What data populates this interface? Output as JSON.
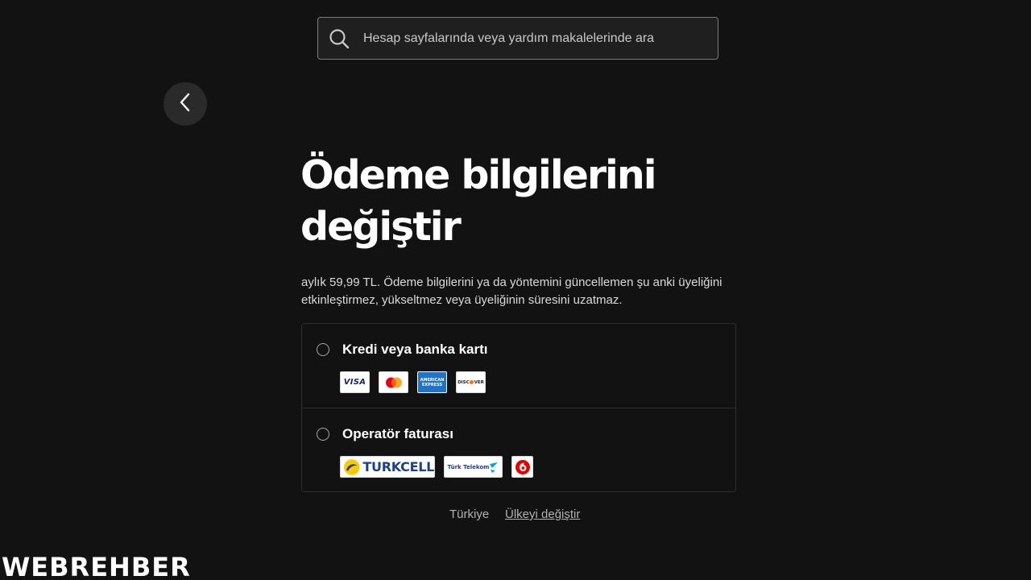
{
  "search": {
    "placeholder": "Hesap sayfalarında veya yardım makalelerinde ara",
    "icon": "search-icon"
  },
  "navigation": {
    "back_icon": "chevron-left-icon"
  },
  "main": {
    "title": "Ödeme bilgilerini değiştir",
    "description": "aylık 59,99 TL. Ödeme bilgilerini ya da yöntemini güncellemen şu anki üyeliğini etkinleştirmez, yükseltmez veya üyeliğinin süresini uzatmaz."
  },
  "payment_options": [
    {
      "label": "Kredi veya banka kartı",
      "selected": false,
      "logos": [
        "VISA",
        "Mastercard",
        "AMERICAN EXPRESS",
        "DISCOVER"
      ]
    },
    {
      "label": "Operatör faturası",
      "selected": false,
      "logos": [
        "TURKCELL",
        "Türk Telekom",
        "Vodafone"
      ]
    }
  ],
  "logo_text": {
    "visa": "VISA",
    "amex_line1": "AMERICAN",
    "amex_line2": "EXPRESS",
    "discover_pre": "DISC",
    "discover_post": "VER",
    "turkcell": "TURKCELL",
    "telekom": "Türk Telekom"
  },
  "footer": {
    "country": "Türkiye",
    "change_country_label": "Ülkeyi değiştir"
  },
  "watermark": {
    "text": "WEBREHBER"
  },
  "colors": {
    "background": "#121212",
    "text_primary": "#ffffff",
    "text_secondary": "#b3b3b3",
    "border": "#2e2e2e",
    "search_border": "#7c7c7c",
    "back_button_bg": "#2a2a2a",
    "turkcell_yellow": "#ffc900",
    "turkcell_blue": "#1d3f8e",
    "mastercard_red": "#eb001b",
    "mastercard_orange": "#f79e1b",
    "amex_blue": "#1f72cd",
    "vodafone_red": "#e60000",
    "watermark_accent": "#e30613"
  }
}
